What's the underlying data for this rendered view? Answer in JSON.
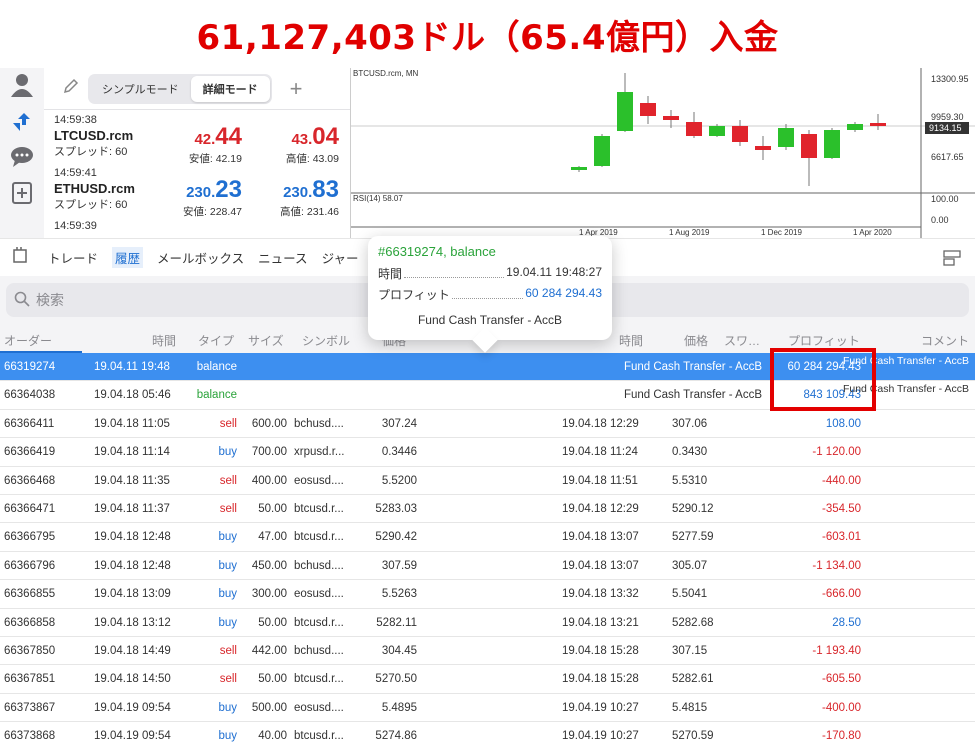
{
  "banner": {
    "text": "61,127,403ドル（65.4億円）入金"
  },
  "toolbar": {
    "mode_simple": "シンプルモード",
    "mode_detail": "詳細モード",
    "add": "+"
  },
  "quotes": [
    {
      "time": "14:59:38",
      "symbol": "LTCUSD.rcm",
      "spread": "スプレッド: 60",
      "bid_prefix": "42.",
      "bid_big": "44",
      "bid_low": "安値: 42.19",
      "ask_prefix": "43.",
      "ask_big": "04",
      "ask_high": "高値: 43.09",
      "color": "red"
    },
    {
      "time": "14:59:41",
      "symbol": "ETHUSD.rcm",
      "spread": "スプレッド: 60",
      "bid_prefix": "230.",
      "bid_big": "23",
      "bid_low": "安値: 228.47",
      "ask_prefix": "230.",
      "ask_big": "83",
      "ask_high": "高値: 231.46",
      "color": "blue"
    },
    {
      "time": "14:59:39"
    }
  ],
  "chart": {
    "symbol_label": "BTCUSD.rcm, MN",
    "price_labels": [
      "13300.95",
      "9959.30",
      "9134.15",
      "6617.65"
    ],
    "indicator_label": "RSI(14) 58.07",
    "indicator_labels": [
      "100.00",
      "0.00"
    ],
    "date_labels": [
      "1 Apr 2019",
      "1 Aug 2019",
      "1 Dec 2019",
      "1 Apr 2020"
    ],
    "up_color": "#2bc02b",
    "down_color": "#e0242c"
  },
  "tabs": [
    "トレード",
    "履歴",
    "メールボックス",
    "ニュース",
    "ジャー"
  ],
  "active_tab": "履歴",
  "search": {
    "placeholder": "検索"
  },
  "columns": {
    "order": "オーダー",
    "time": "時間",
    "type": "タイプ",
    "size": "サイズ",
    "symbol": "シンボル",
    "price": "価格",
    "ctime": "時間",
    "cprice": "価格",
    "swap": "スワ…",
    "profit": "プロフィット",
    "comment": "コメント"
  },
  "popup": {
    "title": "#66319274, balance",
    "time_label": "時間",
    "time_value": "19.04.11 19:48:27",
    "profit_label": "プロフィット",
    "profit_value": "60 284 294.43",
    "comment": "Fund Cash Transfer - AccB"
  },
  "rows": [
    {
      "order": "66319274",
      "time": "19.04.11 19:48",
      "type": "balance",
      "mid": "Fund Cash Transfer - AccB",
      "profit": "60 284 294.43",
      "comment": "Fund Cash Transfer - AccB",
      "selected": true
    },
    {
      "order": "66364038",
      "time": "19.04.18 05:46",
      "type": "balance",
      "mid": "Fund Cash Transfer - AccB",
      "profit": "843 109.43",
      "comment": "Fund Cash Transfer - AccB"
    },
    {
      "order": "66366411",
      "time": "19.04.18 11:05",
      "type": "sell",
      "size": "600.00",
      "symbol": "bchusd....",
      "price": "307.24",
      "ctime": "19.04.18 12:29",
      "cprice": "307.06",
      "profit": "108.00"
    },
    {
      "order": "66366419",
      "time": "19.04.18 11:14",
      "type": "buy",
      "size": "700.00",
      "symbol": "xrpusd.r...",
      "price": "0.3446",
      "ctime": "19.04.18 11:24",
      "cprice": "0.3430",
      "profit": "-1 120.00"
    },
    {
      "order": "66366468",
      "time": "19.04.18 11:35",
      "type": "sell",
      "size": "400.00",
      "symbol": "eosusd....",
      "price": "5.5200",
      "ctime": "19.04.18 11:51",
      "cprice": "5.5310",
      "profit": "-440.00"
    },
    {
      "order": "66366471",
      "time": "19.04.18 11:37",
      "type": "sell",
      "size": "50.00",
      "symbol": "btcusd.r...",
      "price": "5283.03",
      "ctime": "19.04.18 12:29",
      "cprice": "5290.12",
      "profit": "-354.50"
    },
    {
      "order": "66366795",
      "time": "19.04.18 12:48",
      "type": "buy",
      "size": "47.00",
      "symbol": "btcusd.r...",
      "price": "5290.42",
      "ctime": "19.04.18 13:07",
      "cprice": "5277.59",
      "profit": "-603.01"
    },
    {
      "order": "66366796",
      "time": "19.04.18 12:48",
      "type": "buy",
      "size": "450.00",
      "symbol": "bchusd....",
      "price": "307.59",
      "ctime": "19.04.18 13:07",
      "cprice": "305.07",
      "profit": "-1 134.00"
    },
    {
      "order": "66366855",
      "time": "19.04.18 13:09",
      "type": "buy",
      "size": "300.00",
      "symbol": "eosusd....",
      "price": "5.5263",
      "ctime": "19.04.18 13:32",
      "cprice": "5.5041",
      "profit": "-666.00"
    },
    {
      "order": "66366858",
      "time": "19.04.18 13:12",
      "type": "buy",
      "size": "50.00",
      "symbol": "btcusd.r...",
      "price": "5282.11",
      "ctime": "19.04.18 13:21",
      "cprice": "5282.68",
      "profit": "28.50"
    },
    {
      "order": "66367850",
      "time": "19.04.18 14:49",
      "type": "sell",
      "size": "442.00",
      "symbol": "bchusd....",
      "price": "304.45",
      "ctime": "19.04.18 15:28",
      "cprice": "307.15",
      "profit": "-1 193.40"
    },
    {
      "order": "66367851",
      "time": "19.04.18 14:50",
      "type": "sell",
      "size": "50.00",
      "symbol": "btcusd.r...",
      "price": "5270.50",
      "ctime": "19.04.18 15:28",
      "cprice": "5282.61",
      "profit": "-605.50"
    },
    {
      "order": "66373867",
      "time": "19.04.19 09:54",
      "type": "buy",
      "size": "500.00",
      "symbol": "eosusd....",
      "price": "5.4895",
      "ctime": "19.04.19 10:27",
      "cprice": "5.4815",
      "profit": "-400.00"
    },
    {
      "order": "66373868",
      "time": "19.04.19 09:54",
      "type": "buy",
      "size": "40.00",
      "symbol": "btcusd.r...",
      "price": "5274.86",
      "ctime": "19.04.19 10:27",
      "cprice": "5270.59",
      "profit": "-170.80"
    }
  ]
}
